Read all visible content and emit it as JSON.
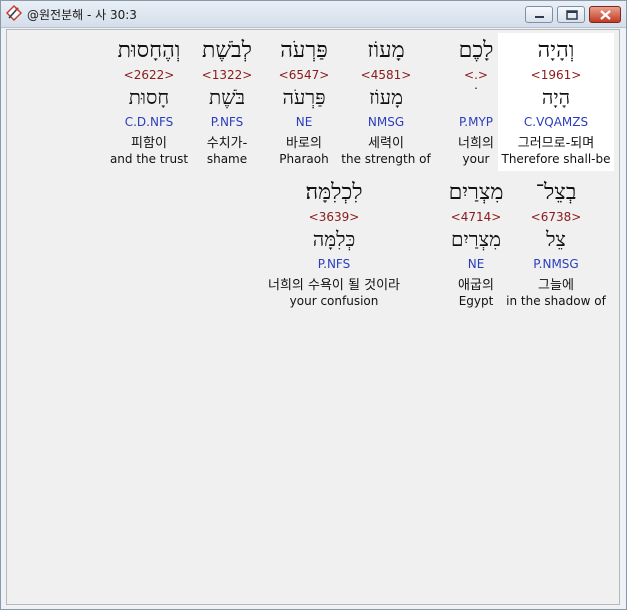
{
  "window": {
    "title": "@원전분해 - 사 30:3"
  },
  "icons": {
    "app": "pen-diamond-icon",
    "minimize": "minimize-icon",
    "maximize": "maximize-icon",
    "close": "close-icon"
  },
  "rows": [
    [
      {
        "hebrew": "וְהָיָה",
        "strong": "<1961>",
        "lemma": "הָיָה",
        "morph": "C.VQAMZS",
        "korean": "그러므로-되며",
        "english": "Therefore shall-be",
        "selected": true
      },
      {
        "hebrew": "לָכֶם",
        "strong": "<.>",
        "lemma": "ׄ",
        "morph": "P.MYP",
        "korean": "너희의",
        "english": "your"
      },
      {
        "hebrew": "מָעוֹז",
        "strong": "<4581>",
        "lemma": "מָעוֹז",
        "morph": "NMSG",
        "korean": "세력이",
        "english": "the strength of"
      },
      {
        "hebrew": "פַּרְעֹה",
        "strong": "<6547>",
        "lemma": "פַּרְעֹה",
        "morph": "NE",
        "korean": "바로의",
        "english": "Pharaoh"
      },
      {
        "hebrew": "לְבֹשֶׁת",
        "strong": "<1322>",
        "lemma": "בֹּשֶׁת",
        "morph": "P.NFS",
        "korean": "수치가-",
        "english": "shame"
      },
      {
        "hebrew": "וְהֶחָסוּת",
        "strong": "<2622>",
        "lemma": "חָסוּת",
        "morph": "C.D.NFS",
        "korean": "피함이",
        "english": "and the trust"
      }
    ],
    [
      {
        "hebrew": "בְצֵל־",
        "strong": "<6738>",
        "lemma": "צֵל",
        "morph": "P.NMSG",
        "korean": "그늘에",
        "english": "in the shadow of"
      },
      {
        "hebrew": "מִצְרַיִם",
        "strong": "<4714>",
        "lemma": "מִצְרַיִם",
        "morph": "NE",
        "korean": "애굽의",
        "english": "Egypt"
      },
      {
        "hebrew": "לִכְלִמָּה׃",
        "strong": "<3639>",
        "lemma": "כְּלִמָּה",
        "morph": "P.NFS",
        "korean": "너희의 수욕이 될 것이라",
        "english": "your confusion"
      }
    ]
  ]
}
